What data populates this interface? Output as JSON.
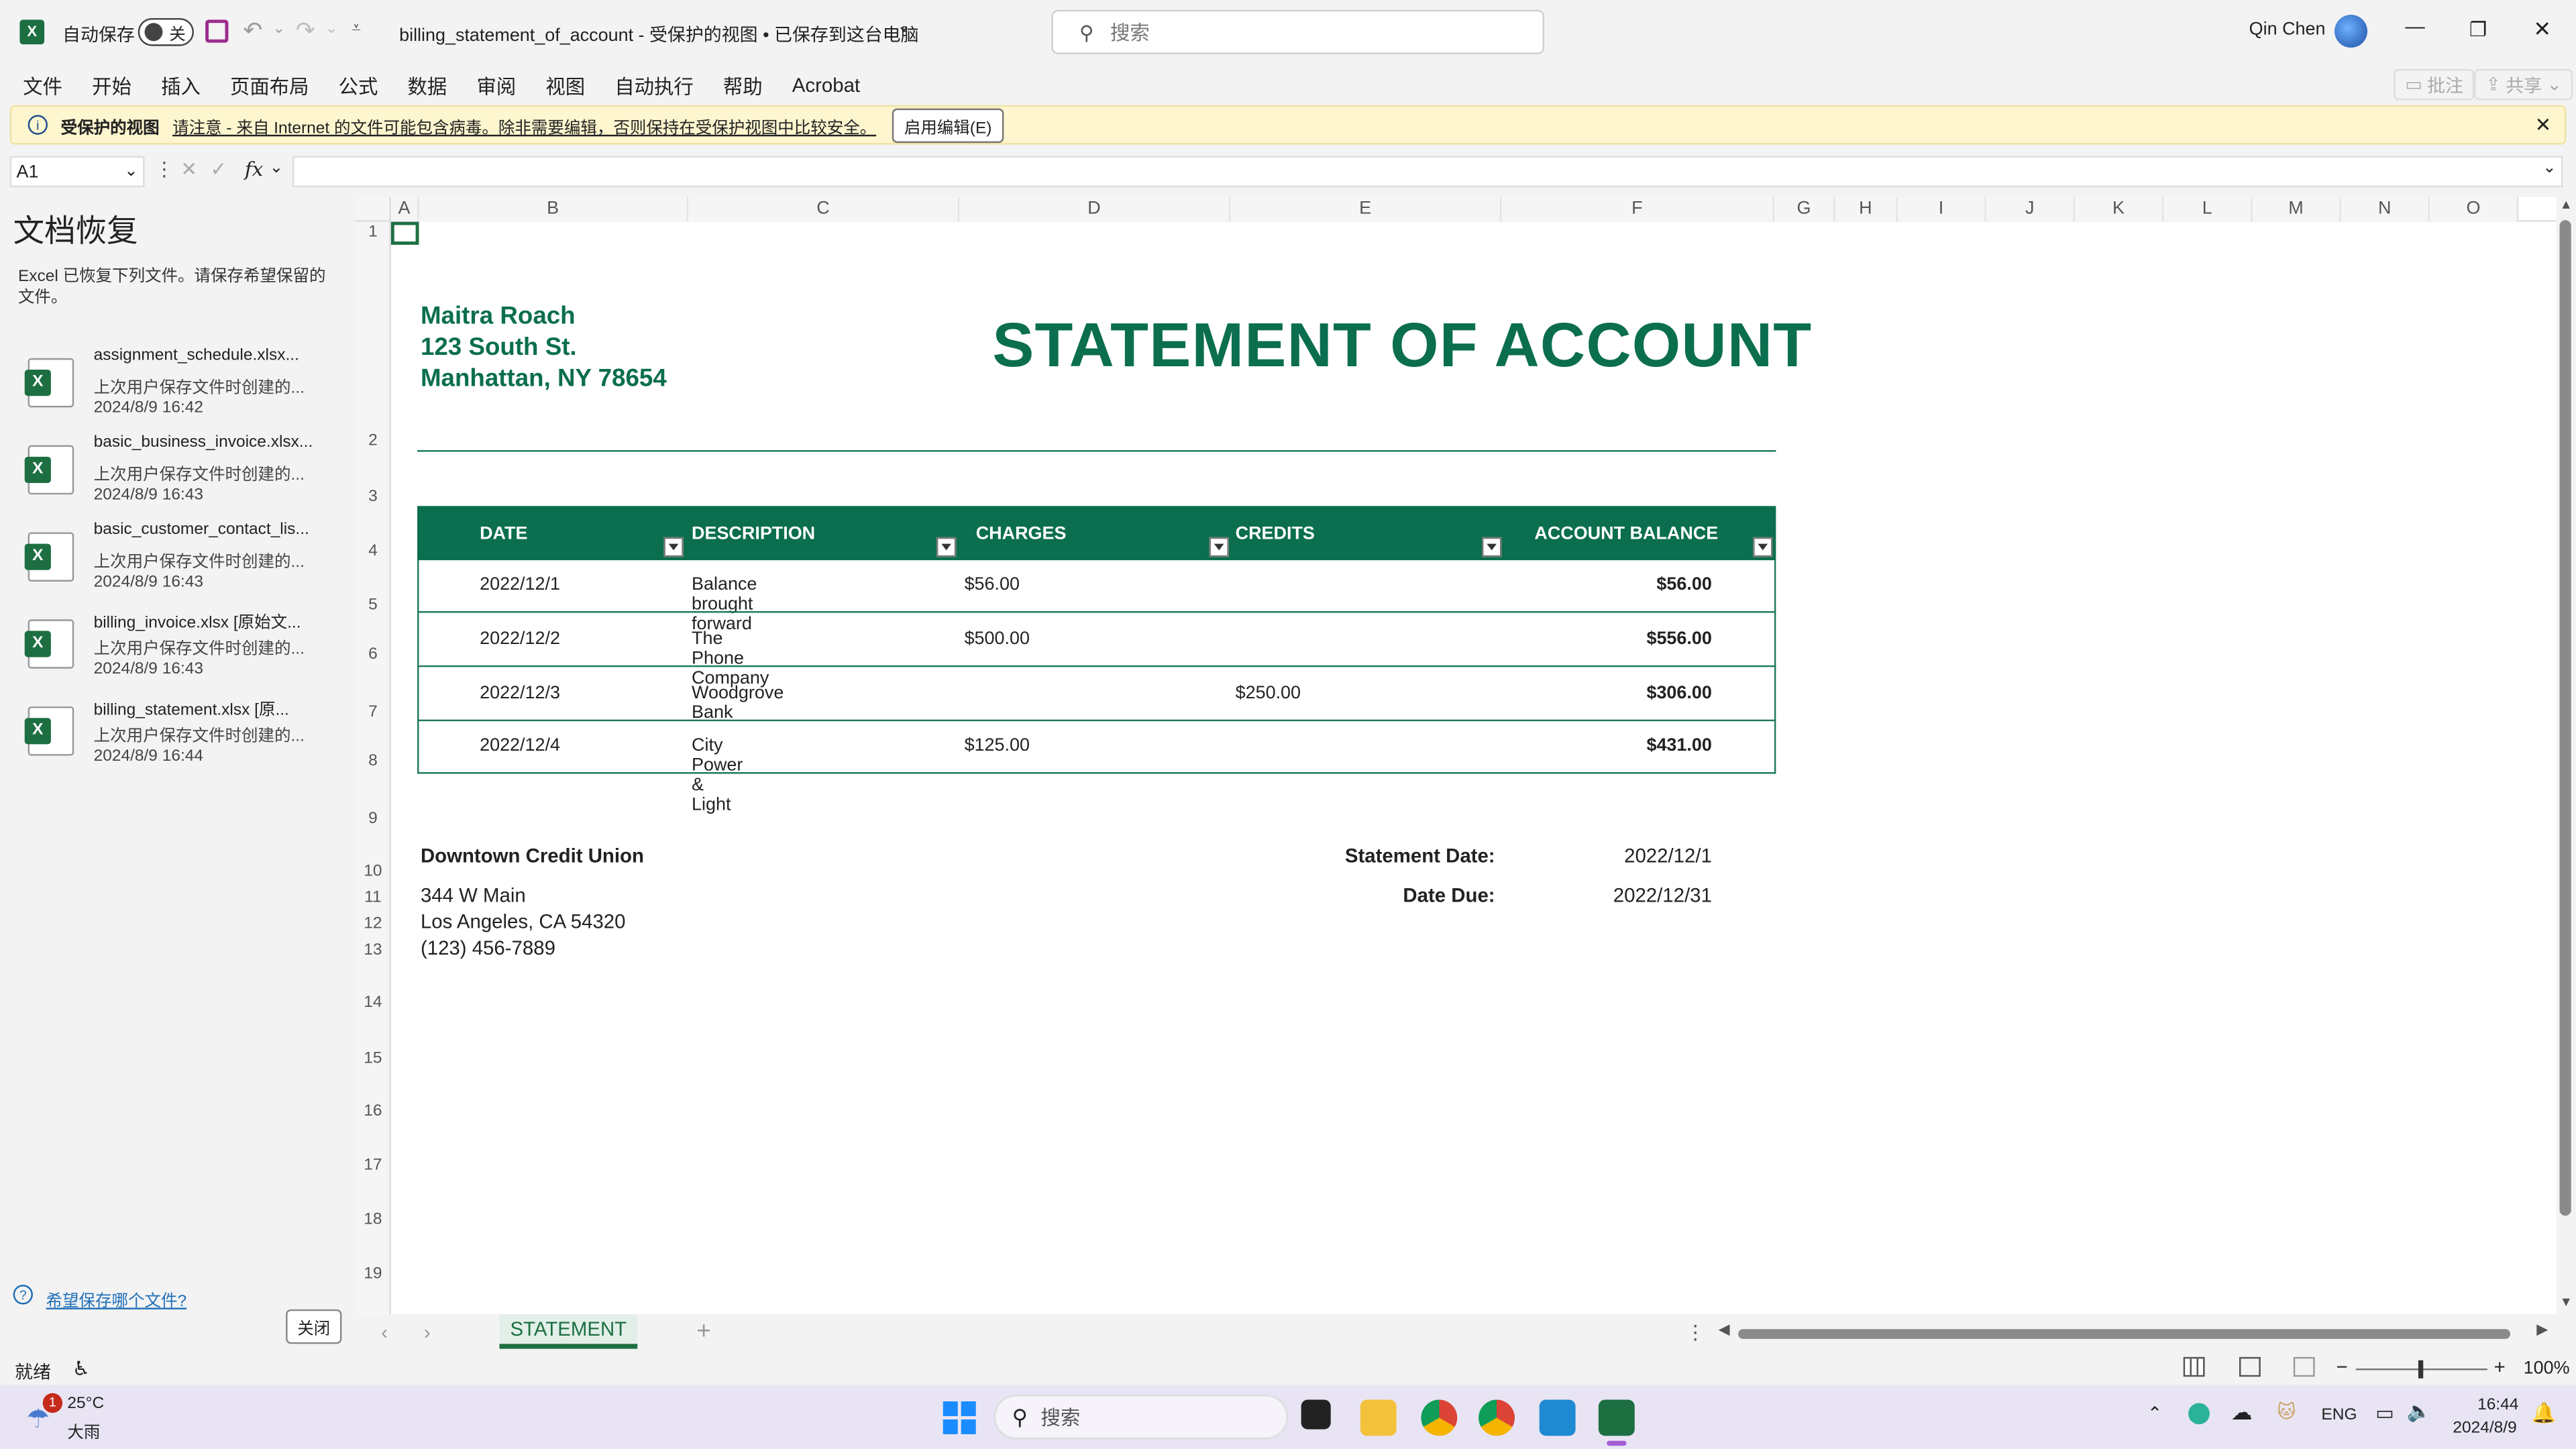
{
  "titlebar": {
    "autosave_label": "自动保存",
    "autosave_state": "关",
    "doc_title": "billing_statement_of_account  -  受保护的视图 • 已保存到这台电脑",
    "search_placeholder": "搜索",
    "user_name": "Qin Chen"
  },
  "menu": {
    "items": [
      "文件",
      "开始",
      "插入",
      "页面布局",
      "公式",
      "数据",
      "审阅",
      "视图",
      "自动执行",
      "帮助",
      "Acrobat"
    ],
    "comments_label": "批注",
    "share_label": "共享"
  },
  "protected_bar": {
    "title": "受保护的视图",
    "message": "请注意 - 来自 Internet 的文件可能包含病毒。除非需要编辑，否则保持在受保护视图中比较安全。",
    "enable_button": "启用编辑(E)"
  },
  "formula_bar": {
    "name_box": "A1",
    "fx": "fx",
    "value": ""
  },
  "recovery": {
    "title": "文档恢复",
    "desc": "Excel 已恢复下列文件。请保存希望保留的文件。",
    "files": [
      {
        "name": "assignment_schedule.xlsx...",
        "desc": "上次用户保存文件时创建的...",
        "time": "2024/8/9 16:42"
      },
      {
        "name": "basic_business_invoice.xlsx...",
        "desc": "上次用户保存文件时创建的...",
        "time": "2024/8/9 16:43"
      },
      {
        "name": "basic_customer_contact_lis...",
        "desc": "上次用户保存文件时创建的...",
        "time": "2024/8/9 16:43"
      },
      {
        "name": "billing_invoice.xlsx  [原始文...",
        "desc": "上次用户保存文件时创建的...",
        "time": "2024/8/9 16:43"
      },
      {
        "name": "billing_statement.xlsx  [原...",
        "desc": "上次用户保存文件时创建的...",
        "time": "2024/8/9 16:44"
      }
    ],
    "help_link": "希望保存哪个文件?",
    "close_button": "关闭"
  },
  "columns": [
    "A",
    "B",
    "C",
    "D",
    "E",
    "F",
    "G",
    "H",
    "I",
    "J",
    "K",
    "L",
    "M",
    "N",
    "O"
  ],
  "rows": [
    "1",
    "2",
    "3",
    "4",
    "5",
    "6",
    "7",
    "8",
    "9",
    "10",
    "11",
    "12",
    "13",
    "14",
    "15",
    "16",
    "17",
    "18",
    "19"
  ],
  "sheet": {
    "sender": {
      "name": "Maitra Roach",
      "street": "123 South St.",
      "city": "Manhattan, NY 78654"
    },
    "title": "STATEMENT OF ACCOUNT",
    "table_headers": [
      "DATE",
      "DESCRIPTION",
      "CHARGES",
      "CREDITS",
      "ACCOUNT BALANCE"
    ],
    "table_rows": [
      {
        "date": "2022/12/1",
        "desc": "Balance brought forward",
        "charges": "$56.00",
        "credits": "",
        "balance": "$56.00"
      },
      {
        "date": "2022/12/2",
        "desc": "The Phone Company",
        "charges": "$500.00",
        "credits": "",
        "balance": "$556.00"
      },
      {
        "date": "2022/12/3",
        "desc": "Woodgrove Bank",
        "charges": "",
        "credits": "$250.00",
        "balance": "$306.00"
      },
      {
        "date": "2022/12/4",
        "desc": "City Power & Light",
        "charges": "$125.00",
        "credits": "",
        "balance": "$431.00"
      }
    ],
    "recipient": {
      "name": "Downtown Credit Union",
      "street": "344 W Main",
      "city": "Los Angeles, CA 54320",
      "phone": "(123) 456-7889"
    },
    "statement_date_label": "Statement Date:",
    "statement_date": "2022/12/1",
    "date_due_label": "Date Due:",
    "date_due": "2022/12/31"
  },
  "sheet_tab": "STATEMENT",
  "status": {
    "ready": "就绪",
    "zoom": "100%"
  },
  "taskbar": {
    "weather_temp": "25°C",
    "weather_desc": "大雨",
    "weather_badge": "1",
    "search_placeholder": "搜索",
    "lang": "ENG",
    "time": "16:44",
    "date": "2024/8/9"
  },
  "colors": {
    "accent": "#0b6e4f",
    "excel_green": "#1d6f42"
  }
}
